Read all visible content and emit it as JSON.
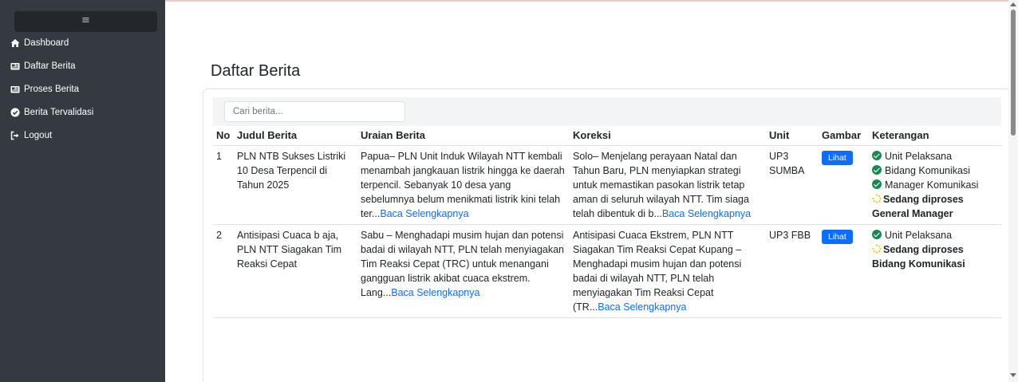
{
  "sidebar": {
    "toggle_icon": "menu-icon",
    "items": [
      {
        "label": "Dashboard",
        "icon": "home-icon"
      },
      {
        "label": "Daftar Berita",
        "icon": "newspaper-icon"
      },
      {
        "label": "Proses Berita",
        "icon": "newspaper-icon"
      },
      {
        "label": "Berita Tervalidasi",
        "icon": "check-circle-icon"
      },
      {
        "label": "Logout",
        "icon": "sign-out-icon"
      }
    ]
  },
  "page": {
    "title": "Daftar Berita"
  },
  "search": {
    "placeholder": "Cari berita..."
  },
  "table": {
    "headers": [
      "No",
      "Judul Berita",
      "Uraian Berita",
      "Koreksi",
      "Unit",
      "Gambar",
      "Keterangan"
    ],
    "rows": [
      {
        "no": "1",
        "judul": "PLN NTB Sukses Listriki 10 Desa Terpencil di Tahun 2025",
        "uraian": "Papua– PLN Unit Induk Wilayah NTT kembali menambah jangkauan listrik hingga ke daerah terpencil. Sebanyak 10 desa yang sebelumnya belum menikmati listrik kini telah ter...",
        "uraian_link": "Baca Selengkapnya",
        "koreksi": "Solo– Menjelang perayaan Natal dan Tahun Baru, PLN menyiapkan strategi untuk memastikan pasokan listrik tetap aman di seluruh wilayah NTT. Tim siaga telah dibentuk di b...",
        "koreksi_link": "Baca Selengkapnya",
        "unit": "UP3 SUMBA",
        "gambar_label": "Lihat",
        "keterangan": {
          "done": [
            "Unit Pelaksana",
            "Bidang Komunikasi",
            "Manager Komunikasi"
          ],
          "pending": "Sedang diproses General Manager"
        }
      },
      {
        "no": "2",
        "judul": "Antisipasi Cuaca b aja, PLN NTT Siagakan Tim Reaksi Cepat",
        "uraian": "Sabu – Menghadapi musim hujan dan potensi badai di wilayah NTT, PLN telah menyiagakan Tim Reaksi Cepat (TRC) untuk menangani gangguan listrik akibat cuaca ekstrem. Lang...",
        "uraian_link": "Baca Selengkapnya",
        "koreksi": "Antisipasi Cuaca Ekstrem, PLN NTT Siagakan Tim Reaksi Cepat Kupang – Menghadapi musim hujan dan potensi badai di wilayah NTT, PLN telah menyiagakan Tim Reaksi Cepat (TR...",
        "koreksi_link": "Baca Selengkapnya",
        "unit": "UP3 FBB",
        "gambar_label": "Lihat",
        "keterangan": {
          "done": [
            "Unit Pelaksana"
          ],
          "pending": "Sedang diproses Bidang Komunikasi"
        }
      }
    ]
  },
  "colors": {
    "sidebar_bg": "#343a40",
    "primary": "#0d6efd",
    "success": "#198754",
    "pending": "#ffc107"
  }
}
